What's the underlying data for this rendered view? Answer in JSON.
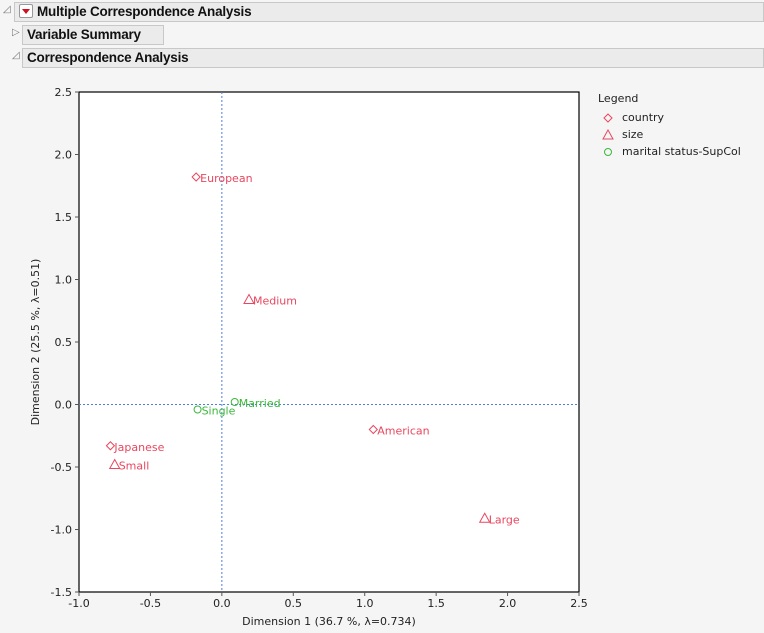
{
  "outline": {
    "top": {
      "title": "Multiple Correspondence Analysis",
      "expanded": true
    },
    "variable_summary": {
      "title": "Variable Summary",
      "expanded": false
    },
    "correspondence": {
      "title": "Correspondence Analysis",
      "expanded": true
    }
  },
  "legend": {
    "title": "Legend",
    "items": [
      {
        "label": "country",
        "marker": "diamond",
        "color": "#e8475f"
      },
      {
        "label": "size",
        "marker": "triangle",
        "color": "#e8475f"
      },
      {
        "label": "marital status-SupCol",
        "marker": "circle",
        "color": "#3cb83c"
      }
    ]
  },
  "chart_data": {
    "type": "scatter",
    "title": "",
    "xlabel": "Dimension 1  (36.7 %, λ=0.734)",
    "ylabel": "Dimension 2  (25.5 %, λ=0.51)",
    "xlim": [
      -1.0,
      2.5
    ],
    "ylim": [
      -1.5,
      2.5
    ],
    "xticks": [
      "-1.0",
      "-0.5",
      "0.0",
      "0.5",
      "1.0",
      "1.5",
      "2.0",
      "2.5"
    ],
    "yticks": [
      "2.5",
      "2.0",
      "1.5",
      "1.0",
      "0.5",
      "0.0",
      "-0.5",
      "-1.0",
      "-1.5"
    ],
    "reference_lines": {
      "x": 0,
      "y": 0
    },
    "grid": false,
    "legend_position": "right",
    "series": [
      {
        "name": "country",
        "marker": "diamond",
        "color": "#e8475f",
        "points": [
          {
            "label": "European",
            "x": -0.18,
            "y": 1.82
          },
          {
            "label": "Japanese",
            "x": -0.78,
            "y": -0.33
          },
          {
            "label": "American",
            "x": 1.06,
            "y": -0.2
          }
        ]
      },
      {
        "name": "size",
        "marker": "triangle",
        "color": "#e8475f",
        "points": [
          {
            "label": "Medium",
            "x": 0.19,
            "y": 0.84
          },
          {
            "label": "Small",
            "x": -0.75,
            "y": -0.48
          },
          {
            "label": "Large",
            "x": 1.84,
            "y": -0.91
          }
        ]
      },
      {
        "name": "marital status-SupCol",
        "marker": "circle",
        "color": "#3cb83c",
        "points": [
          {
            "label": "Married",
            "x": 0.09,
            "y": 0.02
          },
          {
            "label": "Single",
            "x": -0.17,
            "y": -0.04
          }
        ]
      }
    ]
  }
}
